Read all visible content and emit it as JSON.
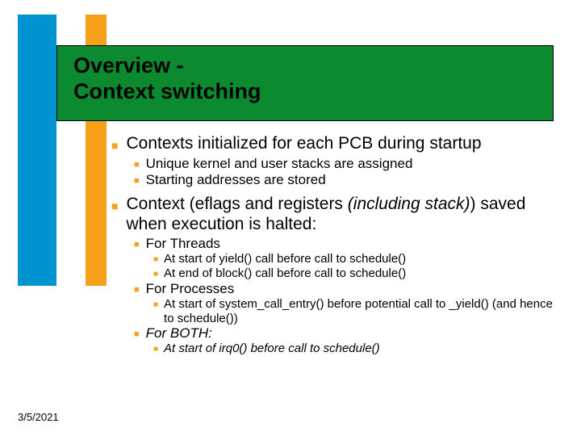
{
  "colors": {
    "blue": "#0093d0",
    "orange": "#f7a11a",
    "green": "#0b8a2f"
  },
  "title_line1": "Overview -",
  "title_line2": "Context switching",
  "bullets": {
    "b0": "Contexts initialized for each PCB during startup",
    "b0_0": "Unique kernel and user stacks are assigned",
    "b0_1": "Starting addresses are stored",
    "b1_pre": "Context (eflags and registers ",
    "b1_italic": "(including stack)",
    "b1_post": ") saved when execution is halted:",
    "b1_0": "For Threads",
    "b1_0_0": "At start of yield() call before call to schedule()",
    "b1_0_1": "At end of block() call before call to schedule()",
    "b1_1": "For Processes",
    "b1_1_0": "At start of system_call_entry() before potential call to _yield() (and hence to schedule())",
    "b1_2": "For BOTH:",
    "b1_2_0": "At start of irq0() before call to schedule()"
  },
  "date": "3/5/2021"
}
